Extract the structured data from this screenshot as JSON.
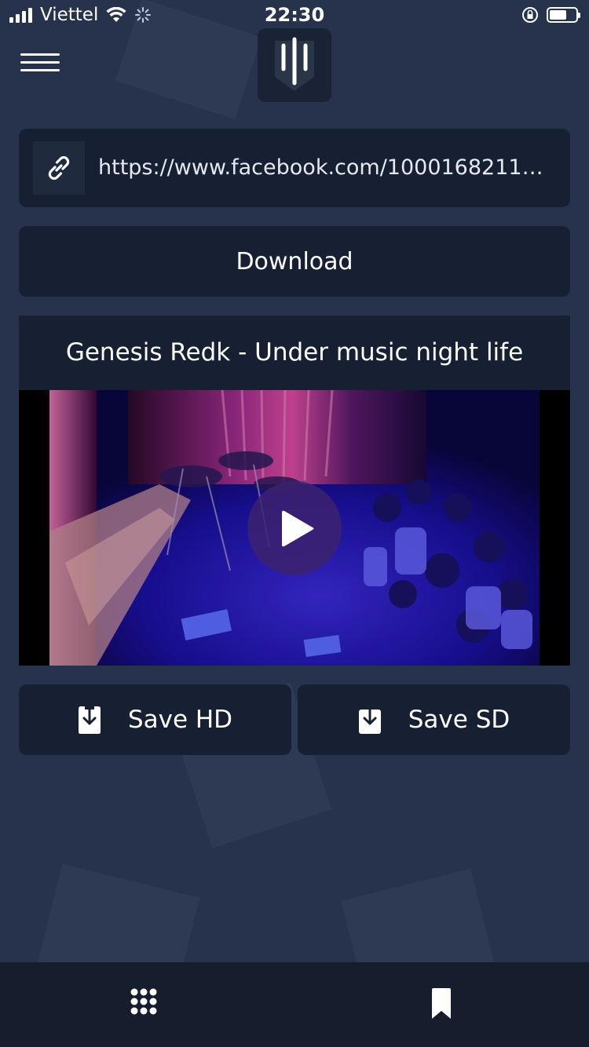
{
  "status_bar": {
    "carrier": "Viettel",
    "time": "22:30",
    "battery_level": 0.7,
    "icons": [
      "signal-icon",
      "wifi-icon",
      "activity-spinner-icon",
      "orientation-lock-icon",
      "battery-icon"
    ]
  },
  "header": {
    "menu_icon": "hamburger-menu-icon",
    "logo_icon": "app-logo-icon"
  },
  "url_input": {
    "icon": "link-icon",
    "value": "https://www.facebook.com/100016821122..."
  },
  "download_button": {
    "label": "Download"
  },
  "video": {
    "title": "Genesis Redk - Under music night life",
    "play_icon": "play-icon"
  },
  "save_buttons": {
    "hd_label": "Save HD",
    "sd_label": "Save SD",
    "icon": "download-icon"
  },
  "tab_bar": {
    "items": [
      {
        "icon": "grid-icon"
      },
      {
        "icon": "bookmark-icon"
      }
    ]
  },
  "colors": {
    "background": "#27334d",
    "card": "#172033",
    "tab_bar": "#161e2e",
    "play_button": "#3c226e"
  }
}
